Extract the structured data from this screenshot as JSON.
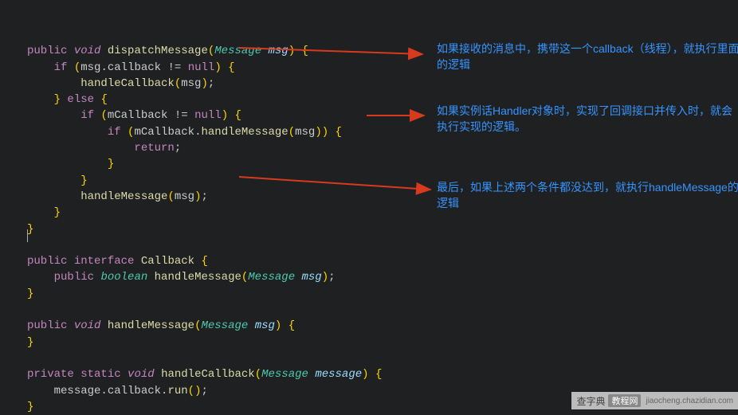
{
  "code": {
    "l1_public": "public",
    "l1_void": "void",
    "l1_fn": "dispatchMessage",
    "l1_type": "Message",
    "l1_param": "msg",
    "l2_if": "if",
    "l2_msg": "msg",
    "l2_callback": "callback",
    "l2_neq": "!=",
    "l2_null": "null",
    "l3_fn": "handleCallback",
    "l3_arg": "msg",
    "l4_else": "else",
    "l5_if": "if",
    "l5_mcb": "mCallback",
    "l5_neq": "!=",
    "l5_null": "null",
    "l6_if": "if",
    "l6_mcb": "mCallback",
    "l6_fn": "handleMessage",
    "l6_arg": "msg",
    "l7_return": "return",
    "l10_fn": "handleMessage",
    "l10_arg": "msg",
    "iface_public": "public",
    "iface_kw": "interface",
    "iface_name": "Callback",
    "iface_m_public": "public",
    "iface_m_ret": "boolean",
    "iface_m_fn": "handleMessage",
    "iface_m_type": "Message",
    "iface_m_param": "msg",
    "hm_public": "public",
    "hm_void": "void",
    "hm_fn": "handleMessage",
    "hm_type": "Message",
    "hm_param": "msg",
    "hc_private": "private",
    "hc_static": "static",
    "hc_void": "void",
    "hc_fn": "handleCallback",
    "hc_type": "Message",
    "hc_param": "message",
    "hc_body_msg": "message",
    "hc_body_cb": "callback",
    "hc_body_run": "run"
  },
  "annotations": {
    "a1": "如果接收的消息中，携带这一个callback（线程），就执行里面的逻辑",
    "a2": "如果实例话Handler对象时，实现了回调接口并传入时，就会执行实现的逻辑。",
    "a3": "最后，如果上述两个条件都没达到，就执行handleMessage的逻辑"
  },
  "watermark": {
    "brand": "查字典",
    "badge": "教程网",
    "url": "jiaocheng.chazidian.com"
  }
}
